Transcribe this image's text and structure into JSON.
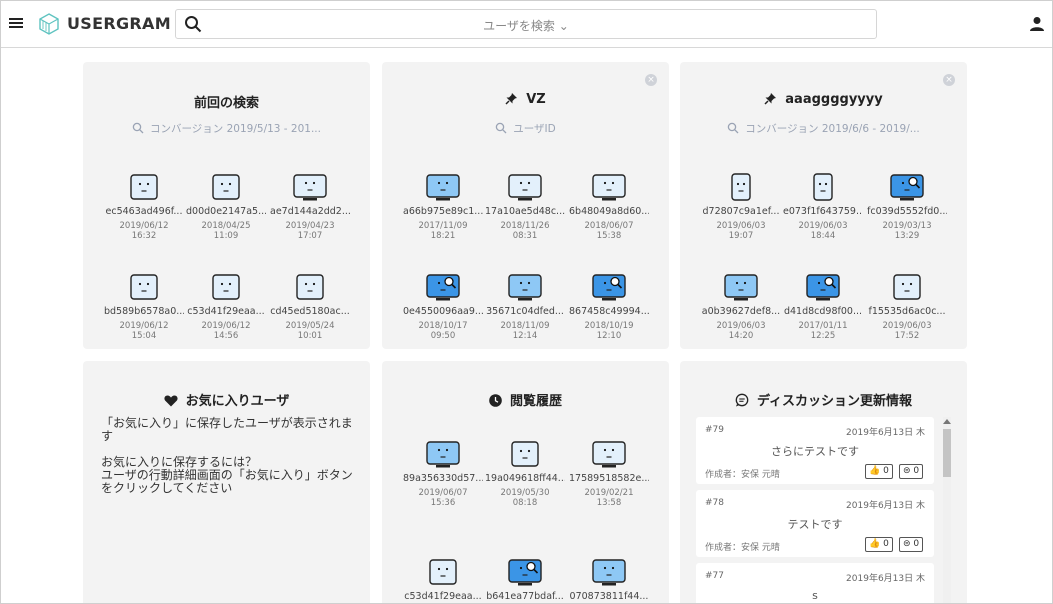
{
  "header": {
    "brand": "USERGRAM",
    "search_placeholder": "ユーザを検索 ⌄",
    "icons": {
      "menu": "hamburger-icon",
      "logo": "cube-logo",
      "search": "search-icon",
      "user": "user-icon"
    }
  },
  "cards": [
    {
      "title": "前回の検索",
      "subtitle": "コンバージョン 2019/5/13 - 201...",
      "users": [
        {
          "id": "ec5463ad496f...",
          "date": "2019/06/12",
          "time": "16:32",
          "style": "light",
          "shape": "box"
        },
        {
          "id": "d00d0e2147a5...",
          "date": "2018/04/25",
          "time": "11:09",
          "style": "light",
          "shape": "box"
        },
        {
          "id": "ae7d144a2dd2...",
          "date": "2019/04/23",
          "time": "17:07",
          "style": "light",
          "shape": "monitor"
        },
        {
          "id": "bd589b6578a0...",
          "date": "2019/06/12",
          "time": "15:04",
          "style": "light",
          "shape": "box"
        },
        {
          "id": "c53d41f29eaa...",
          "date": "2019/06/12",
          "time": "14:56",
          "style": "light",
          "shape": "box"
        },
        {
          "id": "cd45ed5180ac...",
          "date": "2019/05/24",
          "time": "10:01",
          "style": "light",
          "shape": "box"
        }
      ]
    },
    {
      "title": "VZ",
      "subtitle": "ユーザID",
      "users": [
        {
          "id": "a66b975e89c1...",
          "date": "2017/11/09",
          "time": "18:21",
          "style": "mid",
          "shape": "monitor"
        },
        {
          "id": "17a10ae5d48c...",
          "date": "2018/11/26",
          "time": "08:31",
          "style": "light",
          "shape": "monitor"
        },
        {
          "id": "6b48049a8d60...",
          "date": "2018/06/07",
          "time": "15:38",
          "style": "light",
          "shape": "monitor"
        },
        {
          "id": "0e4550096aa9...",
          "date": "2018/10/17",
          "time": "09:50",
          "style": "dark",
          "shape": "monitor"
        },
        {
          "id": "35671c04dfed...",
          "date": "2018/11/09",
          "time": "12:14",
          "style": "mid",
          "shape": "monitor"
        },
        {
          "id": "867458c49994...",
          "date": "2018/10/19",
          "time": "12:10",
          "style": "dark",
          "shape": "monitor"
        }
      ]
    },
    {
      "title": "aaaggggyyyy",
      "subtitle": "コンバージョン 2019/6/6 - 2019/...",
      "users": [
        {
          "id": "d72807c9a1ef...",
          "date": "2019/06/03",
          "time": "19:07",
          "style": "light",
          "shape": "phone"
        },
        {
          "id": "e073f1f643759...",
          "date": "2019/06/03",
          "time": "18:44",
          "style": "light",
          "shape": "phone"
        },
        {
          "id": "fc039d5552fd0...",
          "date": "2019/03/13",
          "time": "13:29",
          "style": "dark",
          "shape": "monitor"
        },
        {
          "id": "a0b39627def8...",
          "date": "2019/06/03",
          "time": "14:20",
          "style": "mid",
          "shape": "monitor"
        },
        {
          "id": "d41d8cd98f00...",
          "date": "2017/01/11",
          "time": "12:25",
          "style": "dark",
          "shape": "monitor"
        },
        {
          "id": "f15535d6ac0c...",
          "date": "2019/06/03",
          "time": "17:52",
          "style": "light",
          "shape": "box"
        }
      ]
    },
    {
      "title": "お気に入りユーザ",
      "text1": "「お気に入り」に保存したユーザが表示されます",
      "text2": "お気に入りに保存するには？",
      "text3": "ユーザの行動詳細画面の「お気に入り」ボタン",
      "text4": "をクリックしてください"
    },
    {
      "title": "閲覧履歴",
      "users": [
        {
          "id": "89a356330d57...",
          "date": "2019/06/07",
          "time": "15:36",
          "style": "mid",
          "shape": "monitor"
        },
        {
          "id": "19a049618ff44...",
          "date": "2019/05/30",
          "time": "08:18",
          "style": "light",
          "shape": "box"
        },
        {
          "id": "17589518582e...",
          "date": "2019/02/21",
          "time": "13:58",
          "style": "light",
          "shape": "monitor"
        },
        {
          "id": "c53d41f29eaa...",
          "date": "",
          "time": "",
          "style": "light",
          "shape": "box"
        },
        {
          "id": "b641ea77bdaf...",
          "date": "",
          "time": "",
          "style": "dark",
          "shape": "monitor"
        },
        {
          "id": "070873811f44...",
          "date": "",
          "time": "",
          "style": "mid",
          "shape": "monitor"
        }
      ]
    },
    {
      "title": "ディスカッション更新情報",
      "items": [
        {
          "num": "#79",
          "date": "2019年6月13日 木",
          "msg": "さらにテストです",
          "author": "作成者：安保 元晴",
          "likes": "0",
          "comments": "0"
        },
        {
          "num": "#78",
          "date": "2019年6月13日 木",
          "msg": "テストです",
          "author": "作成者：安保 元晴",
          "likes": "0",
          "comments": "0"
        },
        {
          "num": "#77",
          "date": "2019年6月13日 木",
          "msg": "s",
          "author": "",
          "likes": "",
          "comments": ""
        }
      ]
    }
  ],
  "colors": {
    "light": "#e3f0fb",
    "mid": "#8ec8f5",
    "dark": "#3b95e6",
    "card_bg": "#f3f3f3"
  }
}
